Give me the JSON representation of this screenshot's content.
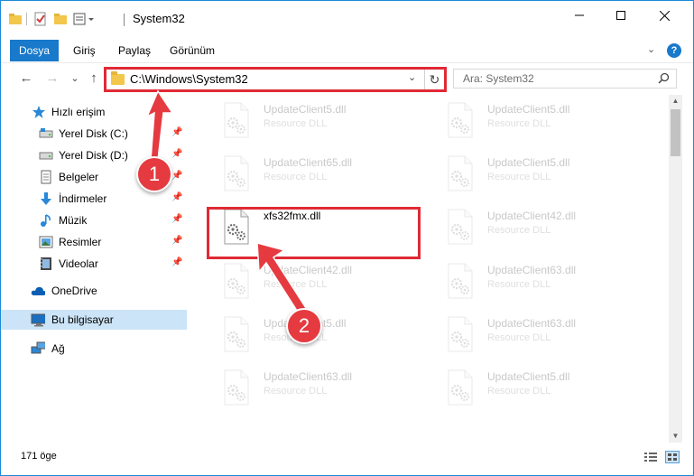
{
  "window": {
    "title": "System32"
  },
  "ribbon": {
    "tabs": [
      {
        "label": "Dosya",
        "active": true
      },
      {
        "label": "Giriş",
        "active": false
      },
      {
        "label": "Paylaş",
        "active": false
      },
      {
        "label": "Görünüm",
        "active": false
      }
    ],
    "help": "?"
  },
  "nav": {
    "back": "←",
    "forward": "→",
    "recent": "⌄",
    "up": "↑",
    "address": "C:\\Windows\\System32",
    "search_placeholder": "Ara: System32"
  },
  "sidebar": {
    "items": [
      {
        "label": "Hızlı erişim",
        "icon": "star-icon",
        "pinned": false
      },
      {
        "label": "Yerel Disk (C:)",
        "icon": "drive-icon",
        "pinned": true
      },
      {
        "label": "Yerel Disk (D:)",
        "icon": "drive-icon",
        "pinned": true
      },
      {
        "label": "Belgeler",
        "icon": "documents-icon",
        "pinned": true
      },
      {
        "label": "İndirmeler",
        "icon": "downloads-icon",
        "pinned": true
      },
      {
        "label": "Müzik",
        "icon": "music-icon",
        "pinned": true
      },
      {
        "label": "Resimler",
        "icon": "pictures-icon",
        "pinned": true
      },
      {
        "label": "Videolar",
        "icon": "videos-icon",
        "pinned": true
      },
      {
        "label": "OneDrive",
        "icon": "onedrive-icon",
        "pinned": false
      },
      {
        "label": "Bu bilgisayar",
        "icon": "computer-icon",
        "pinned": false,
        "selected": true
      },
      {
        "label": "Ağ",
        "icon": "network-icon",
        "pinned": false
      }
    ]
  },
  "files": [
    {
      "name": "UpdateClient5.dll",
      "type": "Resource DLL",
      "highlighted": false
    },
    {
      "name": "UpdateClient5.dll",
      "type": "Resource DLL",
      "highlighted": false
    },
    {
      "name": "UpdateClient65.dll",
      "type": "Resource DLL",
      "highlighted": false
    },
    {
      "name": "UpdateClient5.dll",
      "type": "Resource DLL",
      "highlighted": false
    },
    {
      "name": "xfs32fmx.dll",
      "type": "",
      "highlighted": true
    },
    {
      "name": "UpdateClient42.dll",
      "type": "Resource DLL",
      "highlighted": false
    },
    {
      "name": "UpdateClient42.dll",
      "type": "Resource DLL",
      "highlighted": false
    },
    {
      "name": "UpdateClient63.dll",
      "type": "Resource DLL",
      "highlighted": false
    },
    {
      "name": "UpdateClient5.dll",
      "type": "Resource DLL",
      "highlighted": false
    },
    {
      "name": "UpdateClient63.dll",
      "type": "Resource DLL",
      "highlighted": false
    },
    {
      "name": "UpdateClient63.dll",
      "type": "Resource DLL",
      "highlighted": false
    },
    {
      "name": "UpdateClient5.dll",
      "type": "Resource DLL",
      "highlighted": false
    }
  ],
  "status": {
    "item_count": "171 öge"
  },
  "annotations": {
    "step1": "1",
    "step2": "2",
    "color": "#e53a40"
  }
}
